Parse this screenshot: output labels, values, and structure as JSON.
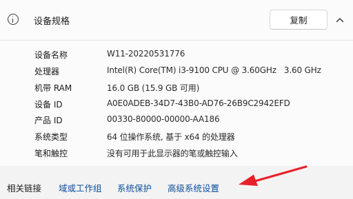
{
  "header": {
    "title": "设备规格",
    "copy_label": "复制"
  },
  "specs": [
    {
      "label": "设备名称",
      "value": "W11-20220531776"
    },
    {
      "label": "处理器",
      "value": "Intel(R) Core(TM) i3-9100 CPU @ 3.60GHz   3.60 GHz"
    },
    {
      "label": "机带 RAM",
      "value": "16.0 GB (15.9 GB 可用)"
    },
    {
      "label": "设备 ID",
      "value": "A0E0ADEB-34D7-43B0-AD76-26B9C2942EFD"
    },
    {
      "label": "产品 ID",
      "value": "00330-80000-00000-AA186"
    },
    {
      "label": "系统类型",
      "value": "64 位操作系统, 基于 x64 的处理器"
    },
    {
      "label": "笔和触控",
      "value": "没有可用于此显示器的笔或触控输入"
    }
  ],
  "related": {
    "label": "相关链接",
    "links": [
      "域或工作组",
      "系统保护",
      "高级系统设置"
    ]
  },
  "colors": {
    "link": "#0b4f9c",
    "annotation_arrow": "#e8202a"
  },
  "icons": [
    "info-icon",
    "chevron-up-icon",
    "arrow-annotation"
  ]
}
